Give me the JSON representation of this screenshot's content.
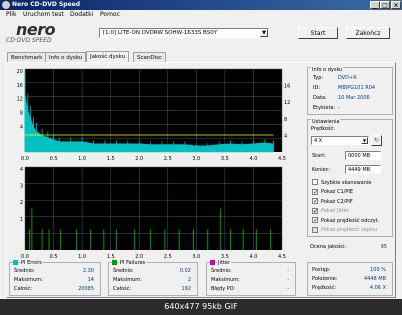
{
  "window": {
    "title": "Nero CD-DVD Speed"
  },
  "menu": [
    "Plik",
    "Uruchom test",
    "Dodatki",
    "Pomoc"
  ],
  "logo": {
    "line1": "nero",
    "line2": "CD·DVD SPEED"
  },
  "drive": {
    "selected": "[1:0]  LITE-ON DVDRW SOHW-1633S BS0Y"
  },
  "buttons": {
    "start": "Start",
    "close": "Zakończ"
  },
  "tabs": [
    "Benchmark",
    "Info o dysku",
    "Jakość dysku",
    "ScanDisc"
  ],
  "disc_info": {
    "title": "Info o dysku",
    "typ_label": "Typ:",
    "typ": "DVD+R",
    "id_label": "ID:",
    "id": "MBIPG101 R04",
    "data_label": "Data:",
    "data": "10 Mar 2006",
    "etykieta_label": "Etykieta:",
    "etykieta": "-"
  },
  "settings": {
    "title": "Ustawienia",
    "speed_label": "Prędkość:",
    "speed": "4 X",
    "start_label": "Start:",
    "start": "0000 MB",
    "end_label": "Koniec:",
    "end": "4449 MB",
    "options": [
      {
        "label": "Szybkie skanowanie",
        "checked": false,
        "enabled": true
      },
      {
        "label": "Pokaż C1/PIE",
        "checked": true,
        "enabled": true
      },
      {
        "label": "Pokaż C2/PIF",
        "checked": true,
        "enabled": true
      },
      {
        "label": "Pokaż Jitter",
        "checked": true,
        "enabled": false
      },
      {
        "label": "Pokaż prędkość odczyt.",
        "checked": true,
        "enabled": true
      },
      {
        "label": "Pokaż prędkość zapisu",
        "checked": false,
        "enabled": false
      }
    ]
  },
  "quality": {
    "label": "Ocena jakości:",
    "value": "95"
  },
  "progress": {
    "postep_label": "Postęp:",
    "postep": "100 %",
    "polozenie_label": "Położenie:",
    "polozenie": "4448 MB",
    "predkosc_label": "Prędkość:",
    "predkosc": "4.06 X"
  },
  "pi_errors": {
    "title": "PI Errors",
    "avg_label": "Średnio:",
    "avg": "2.30",
    "max_label": "Maksimum:",
    "max": "14",
    "total_label": "Całość:",
    "total": "20085"
  },
  "pi_failures": {
    "title": "PI Failures",
    "avg_label": "Średnio:",
    "avg": "0.02",
    "max_label": "Maksimum:",
    "max": "2",
    "total_label": "Całość:",
    "total": "192"
  },
  "jitter": {
    "title": "Jitter",
    "avg_label": "Średnio:",
    "avg": "-",
    "max_label": "Maksimum:",
    "max": "-",
    "po_label": "Błędy PO:",
    "po": "-"
  },
  "colors": {
    "pie": "#00c0c0",
    "pif": "#00a000",
    "jitter": "#c000c0",
    "speed": "#ffff00",
    "grid": "#406060"
  },
  "footer": "640x477  95kb  GIF",
  "chart_data": [
    {
      "type": "area",
      "title": "",
      "x_ticks": [
        "0.0",
        "0.5",
        "1.0",
        "1.5",
        "2.0",
        "2.5",
        "3.0",
        "3.5",
        "4.0",
        "4.5"
      ],
      "y_left_ticks": [
        "20",
        "16",
        "12",
        "8",
        "4"
      ],
      "y_right_ticks": [
        "16",
        "12",
        "8",
        "4"
      ],
      "xlim": [
        0,
        4.5
      ],
      "ylim": [
        0,
        20
      ],
      "series": [
        {
          "values_x": [
            0,
            0.05,
            0.1,
            0.15,
            0.2,
            0.3,
            0.4,
            0.5,
            0.6,
            0.8,
            1.0,
            1.2,
            1.4,
            1.6,
            1.8,
            2.0,
            2.2,
            2.4,
            2.6,
            2.8,
            3.0,
            3.2,
            3.4,
            3.6,
            3.8,
            4.0,
            4.2,
            4.35
          ],
          "values_y": [
            14,
            10,
            8,
            6,
            5,
            4,
            3.5,
            3,
            2.5,
            2.5,
            2.5,
            2,
            2,
            2,
            2,
            2,
            1.8,
            1.8,
            1.8,
            1.8,
            1.5,
            1.5,
            1.8,
            2,
            1.8,
            2,
            2.2,
            2
          ]
        },
        {
          "values_x": [
            0,
            0.5,
            1.0,
            1.5,
            2.0,
            2.5,
            3.0,
            3.5,
            4.0,
            4.35
          ],
          "values_y": [
            4.1,
            4.1,
            4.1,
            4.1,
            4.1,
            4.1,
            4.1,
            4.1,
            4.1,
            4.1
          ]
        }
      ]
    },
    {
      "type": "bar",
      "title": "",
      "x_ticks": [
        "0.0",
        "0.5",
        "1.0",
        "1.5",
        "2.0",
        "2.5",
        "3.0",
        "3.5",
        "4.0",
        "4.5"
      ],
      "y_left_ticks": [
        "4",
        "3",
        "2",
        "1"
      ],
      "xlim": [
        0,
        4.5
      ],
      "ylim": [
        0,
        4
      ],
      "series": [
        {
          "values_x": [
            0.08,
            0.12,
            0.3,
            0.42,
            0.62,
            0.9,
            1.15,
            1.38,
            1.6,
            1.92,
            2.2,
            2.45,
            2.7,
            2.95,
            3.2,
            3.42,
            3.6,
            3.82,
            4.05,
            4.3
          ],
          "values_y": [
            1,
            2,
            1,
            1,
            1,
            1,
            1,
            1,
            1,
            1,
            1,
            1,
            1,
            1,
            1,
            2,
            1,
            1,
            1,
            1
          ]
        }
      ]
    }
  ]
}
